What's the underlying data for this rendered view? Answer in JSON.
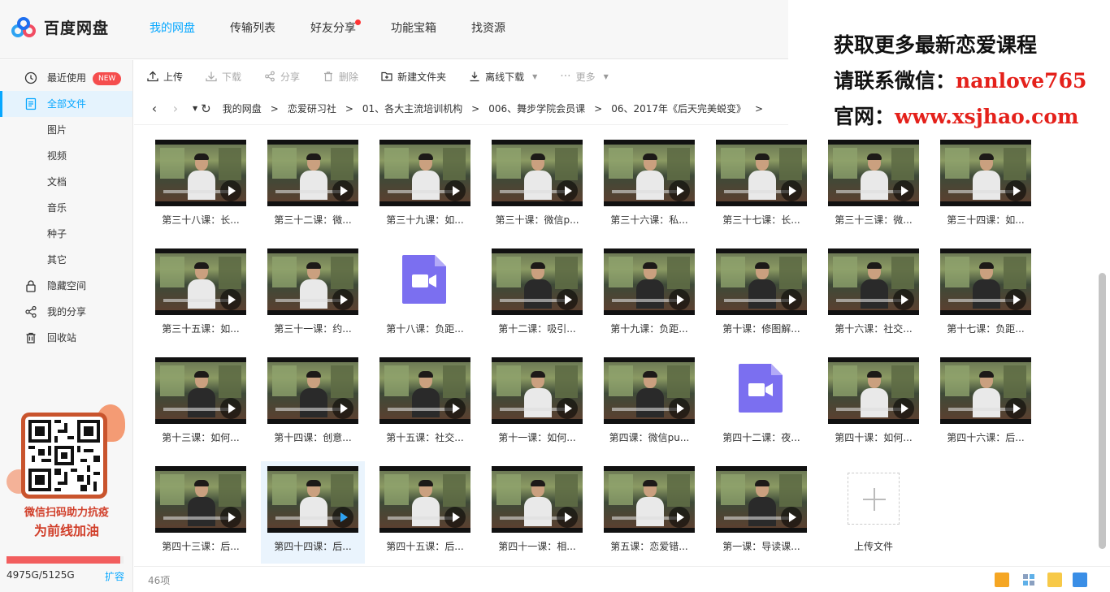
{
  "app": {
    "logo_text": "百度网盘"
  },
  "topnav": [
    {
      "label": "我的网盘",
      "active": true
    },
    {
      "label": "传输列表"
    },
    {
      "label": "好友分享",
      "dot": true
    },
    {
      "label": "功能宝箱"
    },
    {
      "label": "找资源"
    }
  ],
  "promo": {
    "line1": "获取更多最新恋爱课程",
    "line2_label": "请联系微信：",
    "line2_value": "nanlove765",
    "line3_label": "官网：",
    "line3_value": "www.xsjhao.com"
  },
  "sidebar": {
    "recent": "最近使用",
    "new_badge": "NEW",
    "all_files": "全部文件",
    "pictures": "图片",
    "videos": "视频",
    "docs": "文档",
    "music": "音乐",
    "seeds": "种子",
    "others": "其它",
    "hidden_space": "隐藏空间",
    "my_share": "我的分享",
    "recycle": "回收站",
    "qr_caption1": "微信扫码助力抗疫",
    "qr_caption2": "为前线加油",
    "quota_text": "4975G/5125G",
    "quota_used_fraction": 0.971,
    "expand": "扩容"
  },
  "toolbar": {
    "upload": "上传",
    "download": "下载",
    "share": "分享",
    "delete": "删除",
    "new_folder": "新建文件夹",
    "offline_download": "离线下载",
    "more": "更多"
  },
  "breadcrumb": [
    "我的网盘",
    "恋爱研习社",
    "01、各大主流培训机构",
    "006、舞步学院会员课",
    "06、2017年《后天完美蜕变》"
  ],
  "files": [
    {
      "name": "第三十八课：长...",
      "type": "video",
      "shirt": "light"
    },
    {
      "name": "第三十二课：微...",
      "type": "video",
      "shirt": "light"
    },
    {
      "name": "第三十九课：如...",
      "type": "video",
      "shirt": "light"
    },
    {
      "name": "第三十课：微信p...",
      "type": "video",
      "shirt": "light"
    },
    {
      "name": "第三十六课：私...",
      "type": "video",
      "shirt": "light"
    },
    {
      "name": "第三十七课：长...",
      "type": "video",
      "shirt": "light"
    },
    {
      "name": "第三十三课：微...",
      "type": "video",
      "shirt": "light"
    },
    {
      "name": "第三十四课：如...",
      "type": "video",
      "shirt": "light"
    },
    {
      "name": "第三十五课：如...",
      "type": "video",
      "shirt": "light"
    },
    {
      "name": "第三十一课：约...",
      "type": "video",
      "shirt": "light"
    },
    {
      "name": "第十八课：负距...",
      "type": "video-file"
    },
    {
      "name": "第十二课：吸引...",
      "type": "video",
      "shirt": "dark"
    },
    {
      "name": "第十九课：负距...",
      "type": "video",
      "shirt": "dark"
    },
    {
      "name": "第十课：修图解...",
      "type": "video",
      "shirt": "dark"
    },
    {
      "name": "第十六课：社交...",
      "type": "video",
      "shirt": "dark"
    },
    {
      "name": "第十七课：负距...",
      "type": "video",
      "shirt": "dark"
    },
    {
      "name": "第十三课：如何...",
      "type": "video",
      "shirt": "dark"
    },
    {
      "name": "第十四课：创意...",
      "type": "video",
      "shirt": "dark"
    },
    {
      "name": "第十五课：社交...",
      "type": "video",
      "shirt": "dark"
    },
    {
      "name": "第十一课：如何...",
      "type": "video",
      "shirt": "light"
    },
    {
      "name": "第四课：微信pu...",
      "type": "video",
      "shirt": "dark"
    },
    {
      "name": "第四十二课：夜...",
      "type": "video-file"
    },
    {
      "name": "第四十课：如何...",
      "type": "video",
      "shirt": "light"
    },
    {
      "name": "第四十六课：后...",
      "type": "video",
      "shirt": "light"
    },
    {
      "name": "第四十三课：后...",
      "type": "video",
      "shirt": "dark"
    },
    {
      "name": "第四十四课：后...",
      "type": "video",
      "shirt": "light",
      "selected": true
    },
    {
      "name": "第四十五课：后...",
      "type": "video",
      "shirt": "light"
    },
    {
      "name": "第四十一课：相...",
      "type": "video",
      "shirt": "light"
    },
    {
      "name": "第五课：恋爱错...",
      "type": "video",
      "shirt": "light"
    },
    {
      "name": "第一课：导读课...",
      "type": "video",
      "shirt": "dark"
    },
    {
      "name": "上传文件",
      "type": "upload"
    }
  ],
  "status": {
    "count": "46项"
  },
  "colors": {
    "accent": "#06a7ff",
    "promo_red": "#e4211b",
    "video_icon": "#7b6ff0"
  }
}
